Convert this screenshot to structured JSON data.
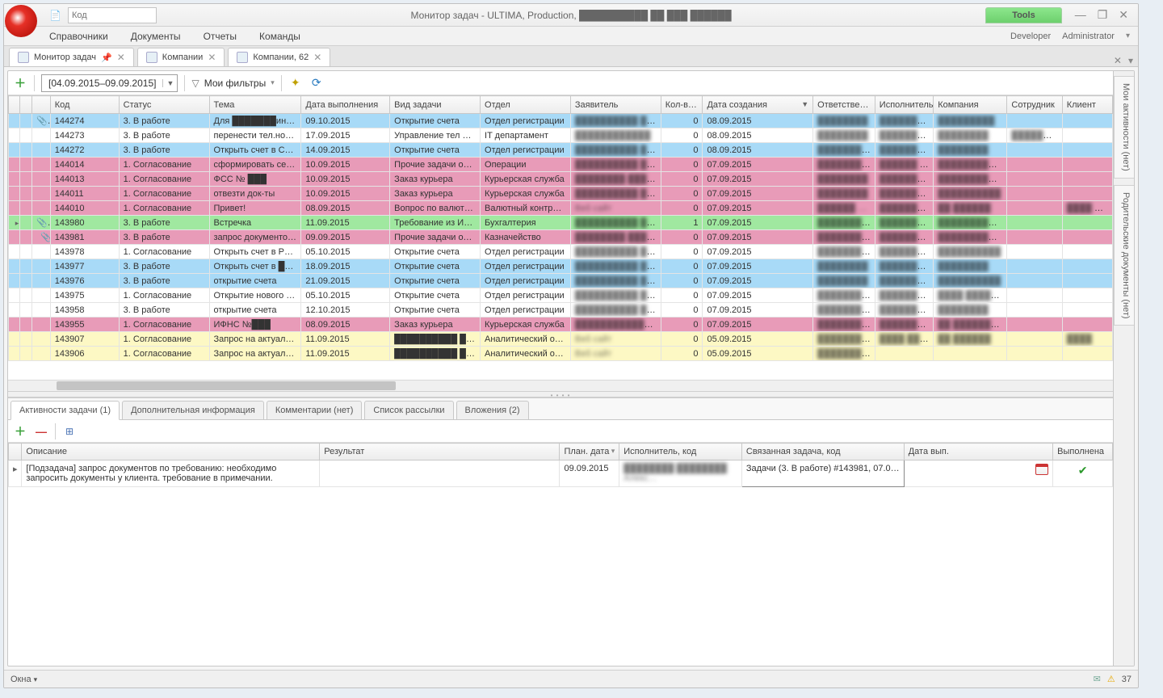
{
  "title_input_placeholder": "Код",
  "app_title": "Монитор задач - ULTIMA, Production, ██████████ ██ ███ ██████",
  "tools_label": "Tools",
  "menubar": {
    "items": [
      "Справочники",
      "Документы",
      "Отчеты",
      "Команды"
    ],
    "right": [
      "Developer",
      "Administrator"
    ]
  },
  "doc_tabs": [
    {
      "label": "Монитор задач",
      "pinned": true
    },
    {
      "label": "Компании",
      "pinned": false
    },
    {
      "label": "Компании, 62",
      "pinned": false
    }
  ],
  "toolbar": {
    "date_range": "[04.09.2015–09.09.2015]",
    "filters_label": "Мои фильтры"
  },
  "side_tabs": [
    "Мои активности (нет)",
    "Родительские документы (нет)"
  ],
  "columns": [
    "",
    "",
    "Код",
    "Статус",
    "Тема",
    "Дата выполнения",
    "Вид задачи",
    "Отдел",
    "Заявитель",
    "Кол-в…",
    "Дата создания",
    "Ответстве…",
    "Исполнитель",
    "Компания",
    "Сотрудник",
    "Клиент"
  ],
  "sorted_col": 10,
  "rows": [
    {
      "cls": "r-blue",
      "attach": true,
      "v": [
        "144274",
        "3. В работе",
        "Для ███████ина.С…",
        "09.10.2015",
        "Открытие счета",
        "Отдел регистрации",
        "██████████ ████…",
        "0",
        "08.09.2015",
        "████████",
        "██████████",
        "█████████",
        "",
        ""
      ]
    },
    {
      "cls": "r-white",
      "attach": false,
      "v": [
        "144273",
        "3. В работе",
        "перенести тел.но…",
        "17.09.2015",
        "Управление тел н…",
        "IT департамент",
        "████████████",
        "0",
        "08.09.2015",
        "████████",
        "██████████",
        "████████",
        "██████████",
        ""
      ]
    },
    {
      "cls": "r-blue",
      "attach": false,
      "v": [
        "144272",
        "3. В работе",
        "Открыть счет в С…",
        "14.09.2015",
        "Открытие счета",
        "Отдел регистрации",
        "██████████ ████…",
        "0",
        "08.09.2015",
        "██████████",
        "████████",
        "████████",
        "",
        ""
      ]
    },
    {
      "cls": "r-pink",
      "attach": false,
      "v": [
        "144014",
        "1. Согласование",
        "сформировать сер…",
        "10.09.2015",
        "Прочие задачи оп…",
        "Операции",
        "██████████ ████…",
        "0",
        "07.09.2015",
        "██████████",
        "██████ ████████",
        "██████████ ██…",
        "",
        ""
      ]
    },
    {
      "cls": "r-pink",
      "attach": false,
      "v": [
        "144013",
        "1. Согласование",
        "ФСС № ███",
        "10.09.2015",
        "Заказ курьера",
        "Курьерская служба",
        "████████ ██████ …",
        "0",
        "07.09.2015",
        "████████",
        "██████████",
        "██████████ █…",
        "",
        ""
      ]
    },
    {
      "cls": "r-pink",
      "attach": false,
      "v": [
        "144011",
        "1. Согласование",
        "отвезти док-ты",
        "10.09.2015",
        "Заказ курьера",
        "Курьерская служба",
        "██████████ ██…",
        "0",
        "07.09.2015",
        "████████",
        "██████████",
        "██████████",
        "",
        ""
      ]
    },
    {
      "cls": "r-pink",
      "attach": false,
      "v": [
        "144010",
        "1. Согласование",
        "Привет!",
        "08.09.2015",
        "Вопрос по валютн…",
        "Валютный контроль",
        "Веб сайт",
        "0",
        "07.09.2015",
        "██████ …",
        "██████████…",
        "██ ██████",
        "",
        "████ ████…"
      ]
    },
    {
      "cls": "r-green",
      "attach": true,
      "exp": true,
      "v": [
        "143980",
        "3. В работе",
        "Встречка",
        "11.09.2015",
        "Требование из ИФ…",
        "Бухгалтерия",
        "██████████ ████████ █…",
        "1",
        "07.09.2015",
        "██████████ █…",
        "██████████",
        "██████████ ██…",
        "",
        ""
      ]
    },
    {
      "cls": "r-pink",
      "child": true,
      "attach": true,
      "v": [
        "143981",
        "3. В работе",
        "запрос документо…",
        "09.09.2015",
        "Прочие задачи от…",
        "Казначейство",
        "████████ ████████████ …",
        "0",
        "07.09.2015",
        "██████████",
        "████████ ████",
        "██████████ ██…",
        "",
        ""
      ]
    },
    {
      "cls": "r-white",
      "attach": false,
      "v": [
        "143978",
        "1. Согласование",
        "Открыть счет в Р…",
        "05.10.2015",
        "Открытие счета",
        "Отдел регистрации",
        "██████████ ████████",
        "0",
        "07.09.2015",
        "██████████",
        "██████████",
        "██████████",
        "",
        ""
      ]
    },
    {
      "cls": "r-blue",
      "attach": false,
      "v": [
        "143977",
        "3. В работе",
        "Открыть счет в ███",
        "18.09.2015",
        "Открытие счета",
        "Отдел регистрации",
        "██████████ ████…",
        "0",
        "07.09.2015",
        "████████",
        "██████████",
        "████████",
        "",
        ""
      ]
    },
    {
      "cls": "r-blue",
      "attach": false,
      "v": [
        "143976",
        "3. В работе",
        "открытие счета",
        "21.09.2015",
        "Открытие счета",
        "Отдел регистрации",
        "██████████ ████…",
        "0",
        "07.09.2015",
        "████████",
        "██████████…",
        "██████████",
        "",
        ""
      ]
    },
    {
      "cls": "r-white",
      "attach": false,
      "v": [
        "143975",
        "1. Согласование",
        "Открытие нового …",
        "05.10.2015",
        "Открытие счета",
        "Отдел регистрации",
        "██████████ ████████",
        "0",
        "07.09.2015",
        "██████████",
        "██████████",
        "████ ████████",
        "",
        ""
      ]
    },
    {
      "cls": "r-white",
      "attach": false,
      "v": [
        "143958",
        "3. В работе",
        "открытие счета",
        "12.10.2015",
        "Открытие счета",
        "Отдел регистрации",
        "██████████ ████████████",
        "0",
        "07.09.2015",
        "██████████",
        "██████████",
        "████████",
        "",
        ""
      ]
    },
    {
      "cls": "r-pink",
      "attach": false,
      "v": [
        "143955",
        "1. Согласование",
        "ИФНС №███",
        "08.09.2015",
        "Заказ курьера",
        "Курьерская служба",
        "██████████████████ ██████ …",
        "0",
        "07.09.2015",
        "██████████",
        "██████████",
        "██ ██████████…",
        "",
        ""
      ]
    },
    {
      "cls": "r-yellow",
      "attach": false,
      "v": [
        "143907",
        "1. Согласование",
        "Запрос на актуал…",
        "11.09.2015",
        "██████████ ████████",
        "Аналитический от…",
        "Веб сайт",
        "0",
        "05.09.2015",
        "██████████…",
        "████ ██ █…",
        "██ ██████",
        "",
        "████"
      ]
    },
    {
      "cls": "r-yellow",
      "attach": false,
      "v": [
        "143906",
        "1. Согласование",
        "Запрос на актуал…",
        "11.09.2015",
        "██████████ ████████",
        "Аналитический от…",
        "Веб сайт",
        "0",
        "05.09.2015",
        "██████████",
        "",
        "",
        "",
        ""
      ]
    }
  ],
  "detail": {
    "tabs": [
      "Активности задачи (1)",
      "Дополнительная информация",
      "Комментарии (нет)",
      "Список рассылки",
      "Вложения (2)"
    ],
    "columns": [
      "Описание",
      "Результат",
      "План. дата",
      "Исполнитель, код",
      "Связанная задача, код",
      "Дата вып.",
      "Выполнена"
    ],
    "row": {
      "desc": "[Подзадача] запрос документов по требованию: необходимо запросить документы у клиента. требование в примечании.",
      "result": "",
      "plan_date": "09.09.2015",
      "executor": "████████ ████████ Алекс…",
      "linked": "Задачи (3. В работе) #143981, 07.0…",
      "date_done": "",
      "done": true
    }
  },
  "statusbar": {
    "left": "Окна",
    "right_count": "37"
  }
}
